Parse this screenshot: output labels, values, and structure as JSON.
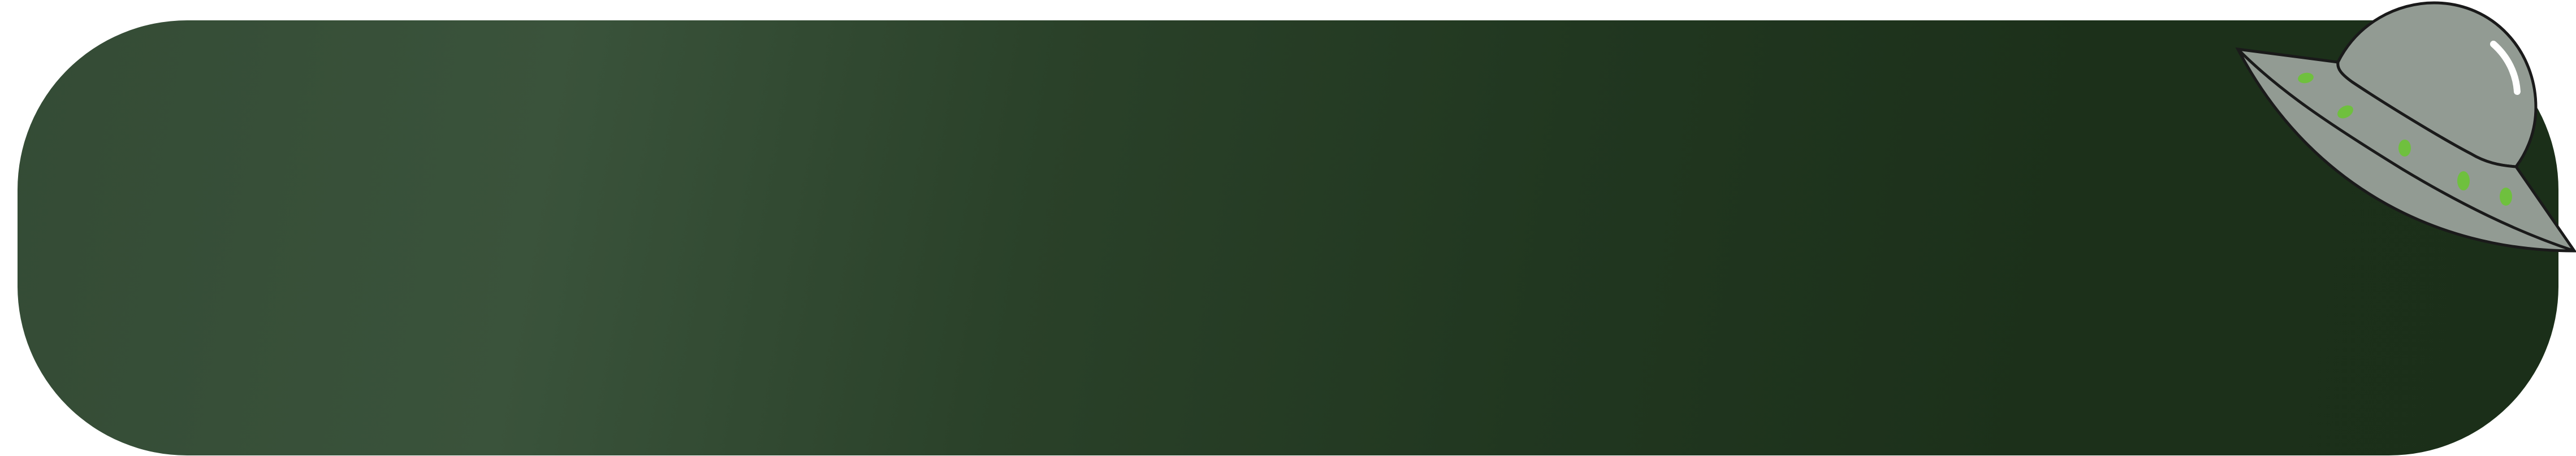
{
  "banner": {
    "gradient_colors": [
      "#344b35",
      "#3a533b",
      "#2a4129",
      "#213720",
      "#1c301a",
      "#1b2f19"
    ]
  },
  "ufo": {
    "icon": "ufo-icon",
    "body_color": "#929b93",
    "outline_color": "#1a1a1a",
    "light_color": "#6fc03e",
    "highlight_color": "#ffffff"
  }
}
